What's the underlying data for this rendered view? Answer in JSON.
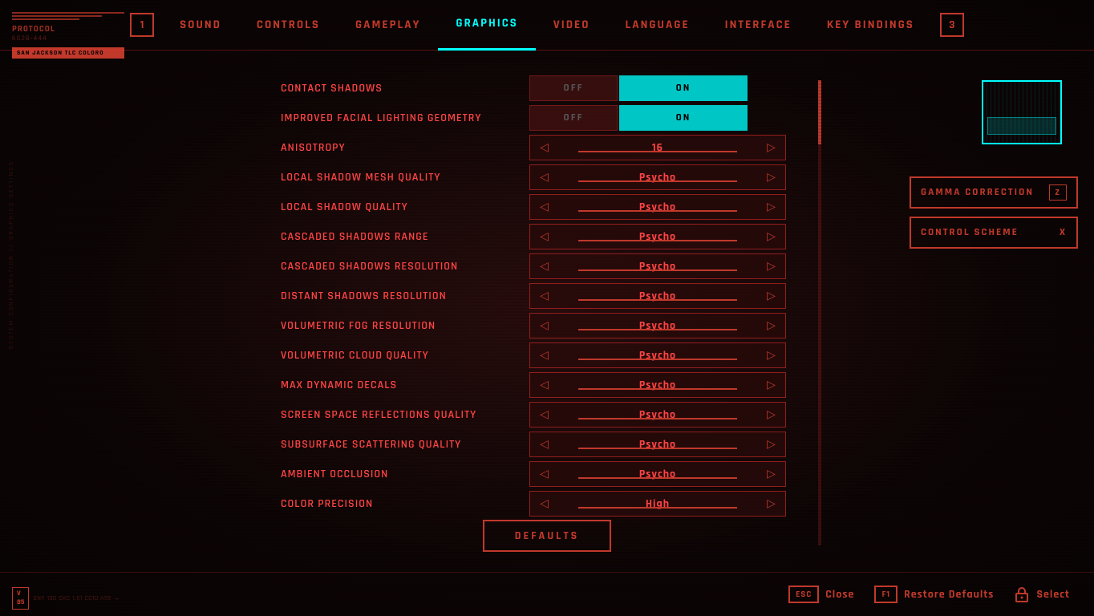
{
  "nav": {
    "items": [
      {
        "id": "sound",
        "label": "SOUND",
        "active": false
      },
      {
        "id": "controls",
        "label": "CONTROLS",
        "active": false
      },
      {
        "id": "gameplay",
        "label": "GAMEPLAY",
        "active": false
      },
      {
        "id": "graphics",
        "label": "GRAPHICS",
        "active": true
      },
      {
        "id": "video",
        "label": "VIDEO",
        "active": false
      },
      {
        "id": "language",
        "label": "LANGUAGE",
        "active": false
      },
      {
        "id": "interface",
        "label": "INTERFACE",
        "active": false
      },
      {
        "id": "key_bindings",
        "label": "KEY BINDINGS",
        "active": false
      }
    ],
    "badge_left": "1",
    "badge_right": "3"
  },
  "logo": {
    "lines_text": "PROTOCOL",
    "sub_text": "6S2B-444",
    "badge_text": "SAN JACKSON TLC COLORO"
  },
  "settings": [
    {
      "label": "Contact Shadows",
      "type": "toggle",
      "value": "ON",
      "off_value": "OFF"
    },
    {
      "label": "Improved Facial Lighting Geometry",
      "type": "toggle",
      "value": "ON",
      "off_value": "OFF"
    },
    {
      "label": "Anisotropy",
      "type": "slider",
      "value": "16"
    },
    {
      "label": "Local Shadow Mesh Quality",
      "type": "slider",
      "value": "Psycho"
    },
    {
      "label": "Local Shadow Quality",
      "type": "slider",
      "value": "Psycho"
    },
    {
      "label": "Cascaded Shadows Range",
      "type": "slider",
      "value": "Psycho"
    },
    {
      "label": "Cascaded Shadows Resolution",
      "type": "slider",
      "value": "Psycho"
    },
    {
      "label": "Distant Shadows Resolution",
      "type": "slider",
      "value": "Psycho"
    },
    {
      "label": "Volumetric Fog Resolution",
      "type": "slider",
      "value": "Psycho"
    },
    {
      "label": "Volumetric Cloud Quality",
      "type": "slider",
      "value": "Psycho"
    },
    {
      "label": "Max Dynamic Decals",
      "type": "slider",
      "value": "Psycho"
    },
    {
      "label": "Screen Space Reflections Quality",
      "type": "slider",
      "value": "Psycho"
    },
    {
      "label": "Subsurface Scattering Quality",
      "type": "slider",
      "value": "Psycho"
    },
    {
      "label": "Ambient Occlusion",
      "type": "slider",
      "value": "Psycho"
    },
    {
      "label": "Color Precision",
      "type": "slider",
      "value": "High"
    }
  ],
  "defaults_btn": "DEFAULTS",
  "gamma_btn": {
    "label": "GAMMA CORRECTION",
    "key": "Z"
  },
  "control_scheme_btn": {
    "label": "CONTROL SCHEME",
    "key": "X"
  },
  "bottom_actions": {
    "close": {
      "key": "ESC",
      "label": "Close"
    },
    "restore": {
      "key": "F1",
      "label": "Restore Defaults"
    },
    "select": {
      "label": "Select"
    }
  },
  "version": {
    "box": "V\n85",
    "text": "GNY 130 CKC 1.51 CC10 A55 →"
  },
  "right_bottom_coords": "→"
}
